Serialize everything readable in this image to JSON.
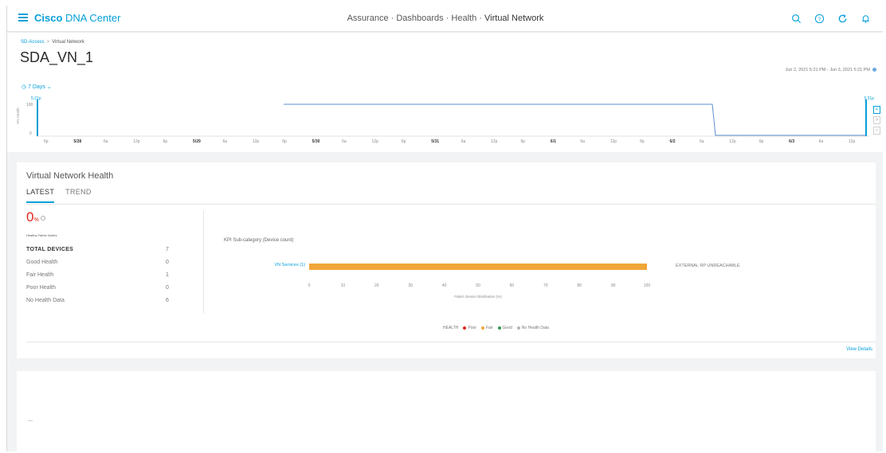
{
  "topbar": {
    "brand_bold": "Cisco",
    "brand_rest": "DNA Center",
    "breadcrumb_prefix": "Assurance · Dashboards · Health · ",
    "breadcrumb_current": "Virtual Network",
    "icons": [
      "search-icon",
      "help-icon",
      "refresh-icon",
      "bell-icon"
    ]
  },
  "page": {
    "breadcrumb_link": "SD-Access",
    "breadcrumb_sep": ">",
    "breadcrumb_current": "Virtual Network",
    "title": "SDA_VN_1",
    "date_range": "Jun 2, 2021 5:21 PM - Jun 3, 2021 5:21 PM",
    "time_selector": "7 Days"
  },
  "timeline": {
    "start_label": "5:21p",
    "end_label": "5:21p",
    "y_top": "100",
    "y_bottom": "0",
    "y_axis_label": "VN Health",
    "ticks": [
      {
        "label": "6p",
        "bold": false
      },
      {
        "label": "5/28",
        "bold": true
      },
      {
        "label": "6a",
        "bold": false
      },
      {
        "label": "12p",
        "bold": false
      },
      {
        "label": "6p",
        "bold": false
      },
      {
        "label": "5/29",
        "bold": true
      },
      {
        "label": "6a",
        "bold": false
      },
      {
        "label": "12p",
        "bold": false
      },
      {
        "label": "6p",
        "bold": false
      },
      {
        "label": "5/30",
        "bold": true
      },
      {
        "label": "6a",
        "bold": false
      },
      {
        "label": "12p",
        "bold": false
      },
      {
        "label": "6p",
        "bold": false
      },
      {
        "label": "5/31",
        "bold": true
      },
      {
        "label": "6a",
        "bold": false
      },
      {
        "label": "12p",
        "bold": false
      },
      {
        "label": "6p",
        "bold": false
      },
      {
        "label": "6/1",
        "bold": true
      },
      {
        "label": "6a",
        "bold": false
      },
      {
        "label": "12p",
        "bold": false
      },
      {
        "label": "6p",
        "bold": false
      },
      {
        "label": "6/2",
        "bold": true
      },
      {
        "label": "6a",
        "bold": false
      },
      {
        "label": "12p",
        "bold": false
      },
      {
        "label": "6p",
        "bold": false
      },
      {
        "label": "6/3",
        "bold": true
      },
      {
        "label": "6a",
        "bold": false
      },
      {
        "label": "12p",
        "bold": false
      }
    ],
    "side_buttons": [
      "<",
      ">",
      "○"
    ]
  },
  "health_card": {
    "title": "Virtual Network Health",
    "tabs": [
      {
        "label": "LATEST",
        "active": true
      },
      {
        "label": "TREND",
        "active": false
      }
    ],
    "big_value": "0",
    "big_unit": "%",
    "big_sub": "Healthy Fabric Nodes",
    "stats": [
      {
        "label": "TOTAL DEVICES",
        "value": "7",
        "total": true
      },
      {
        "label": "Good Health",
        "value": "0",
        "total": false
      },
      {
        "label": "Fair Health",
        "value": "1",
        "total": false
      },
      {
        "label": "Poor Health",
        "value": "0",
        "total": false
      },
      {
        "label": "No Health Data",
        "value": "6",
        "total": false
      }
    ],
    "kpi_title": "KPI Sub-category (Device count)",
    "bar_label": "VN Services (1)",
    "bar_value_pct": 100,
    "bar_color": "#f0a63a",
    "bar_note": "EXTERNAL RP UNREACHABLE",
    "x_ticks": [
      "0",
      "10",
      "20",
      "30",
      "40",
      "50",
      "60",
      "70",
      "80",
      "90",
      "100"
    ],
    "x_title": "Fabric Device Distribution (%)",
    "legend_title": "HEALTH",
    "legend": [
      {
        "label": "Poor",
        "color": "#e2231a"
      },
      {
        "label": "Fair",
        "color": "#f0a63a"
      },
      {
        "label": "Good",
        "color": "#2e9a4f"
      },
      {
        "label": "No Health Data",
        "color": "#b5b5b5"
      }
    ],
    "view_details": "View Details"
  },
  "colors": {
    "accent": "#049fd9",
    "line": "#5b8fd1",
    "critical": "#e2231a"
  }
}
